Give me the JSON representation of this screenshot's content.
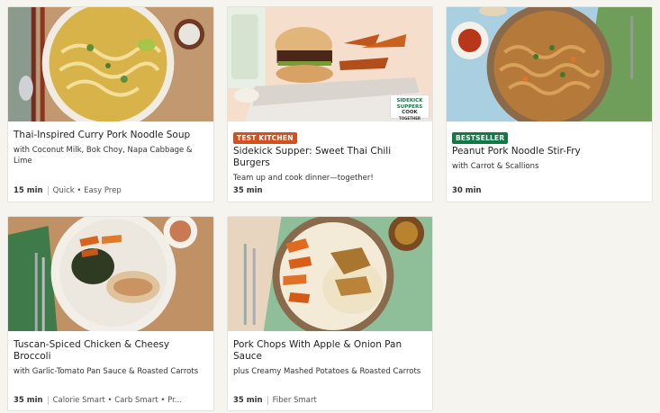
{
  "cards": [
    {
      "title": "Thai-Inspired Curry Pork Noodle Soup",
      "subtitle": "with Coconut Milk, Bok Choy, Napa Cabbage & Lime",
      "time": "15 min",
      "tags": "Quick • Easy Prep",
      "badge": ""
    },
    {
      "title": "Sidekick Supper: Sweet Thai Chili Burgers",
      "subtitle": "Team up and cook dinner—together!",
      "time": "35 min",
      "tags": "",
      "badge": "TEST KITCHEN",
      "image_logo": [
        "SIDEKICK",
        "SUPPERS",
        "COOK",
        "TOGETHER"
      ]
    },
    {
      "title": "Peanut Pork Noodle Stir-Fry",
      "subtitle": "with Carrot & Scallions",
      "time": "30 min",
      "tags": "",
      "badge": "BESTSELLER"
    },
    {
      "title": "Tuscan-Spiced Chicken & Cheesy Broccoli",
      "subtitle": "with Garlic-Tomato Pan Sauce & Roasted Carrots",
      "time": "35 min",
      "tags": "Calorie Smart • Carb Smart • Pr...",
      "badge": ""
    },
    {
      "title": "Pork Chops With Apple & Onion Pan Sauce",
      "subtitle": "plus Creamy Mashed Potatoes & Roasted Carrots",
      "time": "35 min",
      "tags": "Fiber Smart",
      "badge": ""
    }
  ],
  "colors": {
    "badge_orange": "#d4501d",
    "badge_green": "#0f7a45"
  }
}
